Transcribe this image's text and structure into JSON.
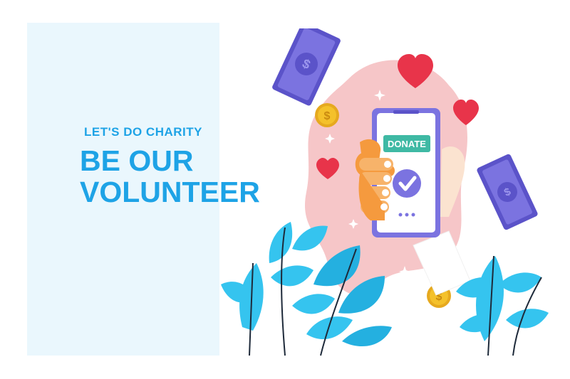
{
  "headline": {
    "kicker": "LET'S DO CHARITY",
    "line1": "BE OUR",
    "line2": "VOLUNTEER"
  },
  "phone": {
    "button_label": "DONATE"
  },
  "colors": {
    "accent": "#1ea3e6",
    "panel": "#eaf7fd",
    "blob": "#f6c6c8",
    "phone": "#7b73e0",
    "donate_button": "#3fb9a4",
    "heart": "#e8344a",
    "coin": "#f4c12b",
    "bill": "#7b73e0",
    "leaf": "#35c4ef"
  },
  "icons": [
    "heart-icon",
    "coin-icon",
    "money-bill-icon",
    "check-icon",
    "sparkle-icon",
    "leaf-icon",
    "hand-icon",
    "phone-icon"
  ]
}
